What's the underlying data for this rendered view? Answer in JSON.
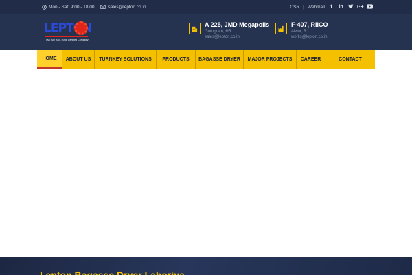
{
  "topbar": {
    "hours": "Mon - Sat: 9:00 - 18:00",
    "email": "sales@lepton.co.in",
    "csr": "CSR",
    "separator": "|",
    "webmail": "Webmail",
    "social": [
      "f",
      "in",
      "t",
      "G+",
      "yt"
    ]
  },
  "header": {
    "logo": {
      "word": "LEPTON",
      "tagline": "(An ISO 9001:2008 Certified Company)"
    },
    "contacts": [
      {
        "title": "A 225, JMD Megapolis",
        "line1": "Gurugram, HR",
        "line2": "sales@lepton.co.in",
        "icon": "building-icon"
      },
      {
        "title": "F-407, RIICO",
        "line1": "Alwar, RJ",
        "line2": "works@lepton.co.in",
        "icon": "factory-icon"
      }
    ]
  },
  "nav": {
    "items": [
      "HOME",
      "ABOUT US",
      "TURNKEY SOLUTIONS",
      "PRODUCTS",
      "BAGASSE DRYER",
      "MAJOR PROJECTS",
      "CAREER",
      "CONTACT"
    ],
    "active": "HOME"
  },
  "banner": {
    "text": "Lepton Bagasse Dryer Lahoriya"
  },
  "colors": {
    "accent": "#f5c000",
    "dark": "#202c48",
    "header": "#253250",
    "brand_blue": "#2b4bd6",
    "brand_red": "#e0261b"
  }
}
